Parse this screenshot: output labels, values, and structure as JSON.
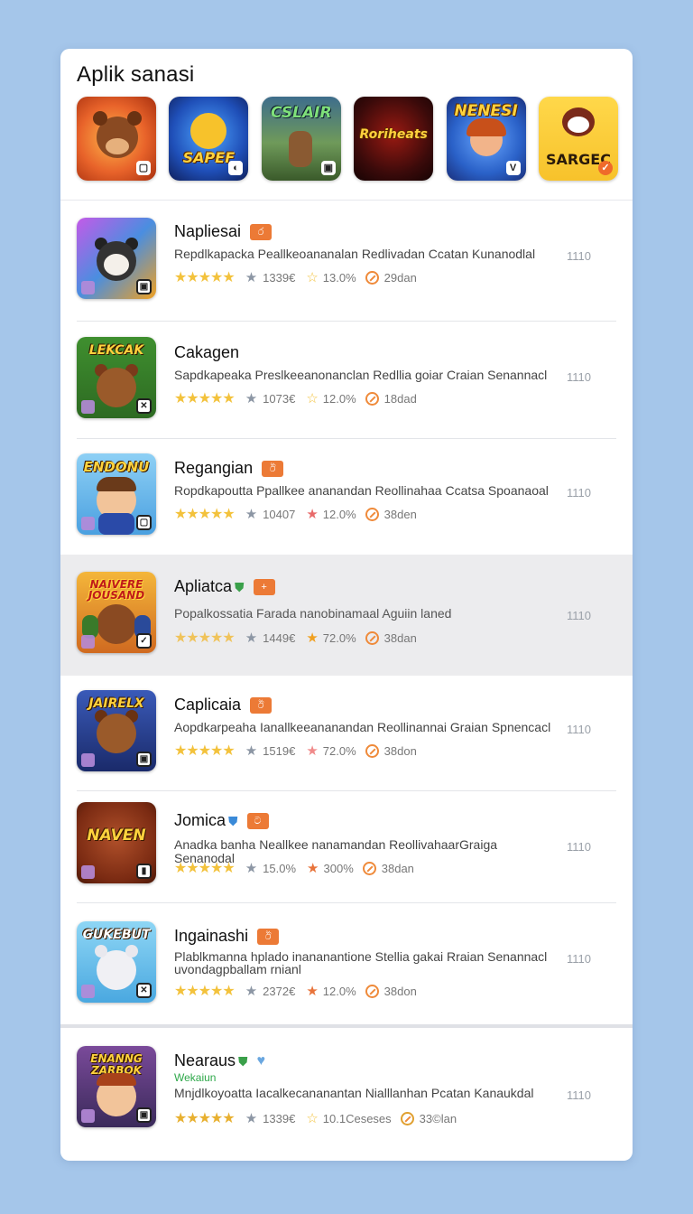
{
  "header": {
    "title": "Aplik  sanasi"
  },
  "featured": [
    {
      "label": "",
      "badge": "▢",
      "bg": "#e8632a"
    },
    {
      "label": "SAPEF",
      "badge": "◐",
      "bg": "#1f4fb8"
    },
    {
      "label": "CSLAIR",
      "badge": "▣",
      "bg": "#5a8f45"
    },
    {
      "label": "Roriheats",
      "badge": "",
      "bg": "#3a0a0a"
    },
    {
      "label": "NENESI",
      "badge": "V",
      "bg": "#2a61c8"
    },
    {
      "label": "SARGEC",
      "badge": "✓",
      "bg": "#f7c22b"
    }
  ],
  "apps": [
    {
      "name": "Napliesai",
      "tag": "ර",
      "icon_text": "",
      "icon_bg": "#4a8ee0",
      "desc": "Repdlkapacka Peallkeoananalan Redlivadan Ccatan Kunanodlal",
      "number": "1110",
      "stars": "★★★★★",
      "m1": "1339€",
      "m2": "13.0%",
      "m2_icon": "☆",
      "m3": "29dan"
    },
    {
      "name": "Cakagen",
      "tag": "",
      "icon_text": "LEKCAK",
      "icon_bg": "#3f8f2f",
      "desc": "Sapdkapeaka Preslkeeanonanclan Redllia goiar Craian Senannacl",
      "number": "1110",
      "stars": "★★★★★",
      "m1": "1073€",
      "m2": "12.0%",
      "m2_icon": "☆",
      "m3": "18dad"
    },
    {
      "name": "Regangian",
      "tag": "ඊ",
      "icon_text": "ENDONU",
      "icon_bg": "#6fb3e8",
      "desc": "Ropdkapoutta Ppallkee ananandan Reollinahaa Ccatsa Spoanaoal",
      "number": "1110",
      "stars": "★★★★★",
      "m1": "10407",
      "m2": "12.0%",
      "m2_icon": "★",
      "m3": "38den"
    },
    {
      "name": "Apliatca",
      "tag": "+",
      "icon_text": "NAIVERE JOUSAND",
      "icon_bg": "#e9a825",
      "desc": "Popalkossatia Farada nanobinamaal Aguiin laned",
      "number": "1110",
      "stars": "★★★★★",
      "m1": "1449€",
      "m2": "72.0%",
      "m2_icon": "★",
      "m3": "38dan"
    },
    {
      "name": "Caplicaia",
      "tag": "ඊ",
      "icon_text": "JAIRELX",
      "icon_bg": "#2a3f8a",
      "desc": "Aopdkarpeaha Ianallkeeananandan Reollinannai Graian Spnencacl",
      "number": "1110",
      "stars": "★★★★★",
      "m1": "1519€",
      "m2": "72.0%",
      "m2_icon": "★",
      "m3": "38don"
    },
    {
      "name": "Jomica",
      "tag": "ට",
      "icon_text": "NAVEN",
      "icon_bg": "#8a3a1f",
      "desc": "Anadka banha Neallkee nanamandan ReollivahaarGraiga Senanodal",
      "number": "1110",
      "stars": "★★★★★",
      "m1": "15.0%",
      "m2": "300%",
      "m2_icon": "★",
      "m3": "38dan"
    },
    {
      "name": "Ingainashi",
      "tag": "ඊ",
      "icon_text": "GUKEBUT",
      "icon_bg": "#7cc4ea",
      "desc": "Plablkmanna hplado inananantione Stellia gakai Rraian Senannacl uvondagpballam rnianl",
      "number": "1110",
      "stars": "★★★★★",
      "m1": "2372€",
      "m2": "12.0%",
      "m2_icon": "★",
      "m3": "38don"
    },
    {
      "name": "Nearaus",
      "sub": "Wekaiun",
      "tag": "",
      "icon_text": "ENANNG ZARBOK",
      "icon_bg": "#5a3a7a",
      "desc": "Mnjdlkoyoatta Iacalkecananantan Nialllanhan Pcatan Kanaukdal",
      "number": "1110",
      "stars": "★★★★★",
      "m1": "1339€",
      "m2": "10.1Ceseses",
      "m2_icon": "☆",
      "m3": "33©lan"
    }
  ]
}
